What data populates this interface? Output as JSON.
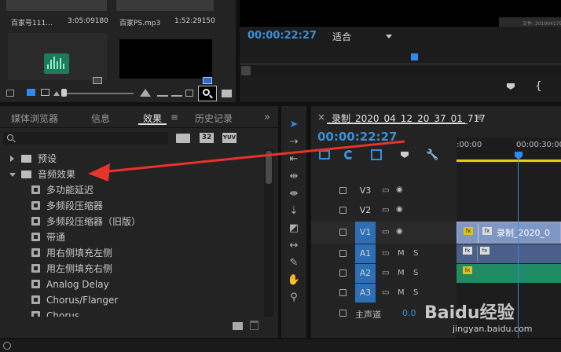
{
  "project": {
    "clips": [
      {
        "name": "百家号111...",
        "duration": "3:05:09180"
      },
      {
        "name": "百家PS.mp3",
        "duration": "1:52:29150"
      }
    ]
  },
  "monitor": {
    "timecode": "00:00:22:27",
    "fit_label": "适合",
    "thumb_caption": "文件: 2019041794"
  },
  "effects_panel": {
    "tabs": [
      "媒体浏览器",
      "信息",
      "效果",
      "历史记录"
    ],
    "active_tab": "效果",
    "menu_icon": "≡",
    "tab_overflow": "»",
    "filter_buttons": [
      "32",
      "YUV"
    ],
    "tree": [
      {
        "label": "预设",
        "level": 0,
        "expanded": false
      },
      {
        "label": "音频效果",
        "level": 0,
        "expanded": true
      },
      {
        "label": "多功能延迟",
        "level": 1
      },
      {
        "label": "多频段压缩器",
        "level": 1
      },
      {
        "label": "多频段压缩器（旧版）",
        "level": 1
      },
      {
        "label": "带通",
        "level": 1
      },
      {
        "label": "用右侧填充左侧",
        "level": 1
      },
      {
        "label": "用左侧填充右侧",
        "level": 1
      },
      {
        "label": "Analog Delay",
        "level": 1
      },
      {
        "label": "Chorus/Flanger",
        "level": 1
      },
      {
        "label": "Chorus",
        "level": 1
      }
    ]
  },
  "timeline": {
    "sequence_name": "录制_2020_04_12_20_37_01_717",
    "menu_icon": "≡",
    "close_icon": "×",
    "timecode": "00:00:22:27",
    "ruler": [
      ":00:00",
      "00:00:30:00"
    ],
    "tracks": [
      {
        "id": "V3",
        "type": "video",
        "highlight": false
      },
      {
        "id": "V2",
        "type": "video",
        "highlight": false
      },
      {
        "id": "V1",
        "type": "video",
        "highlight": true
      },
      {
        "id": "A1",
        "type": "audio",
        "highlight": true
      },
      {
        "id": "A2",
        "type": "audio",
        "highlight": true
      },
      {
        "id": "A3",
        "type": "audio",
        "highlight": true
      }
    ],
    "master": {
      "label": "主声道",
      "value": "0.0"
    },
    "audio_toggles": [
      "M",
      "S"
    ],
    "clip_label": "录制_2020_0",
    "fx_badge": "fx"
  },
  "watermark": {
    "text": "Baidu经验",
    "url": "jingyan.baidu.com"
  },
  "colors": {
    "accent_blue": "#2d8ceb",
    "timecode_blue": "#3a8fd8",
    "video_clip": "#6b86b8",
    "audio_clip": "#1f8a63",
    "playhead": "#2d8ceb",
    "work_area": "#e8d000",
    "arrow": "#e8332a"
  }
}
